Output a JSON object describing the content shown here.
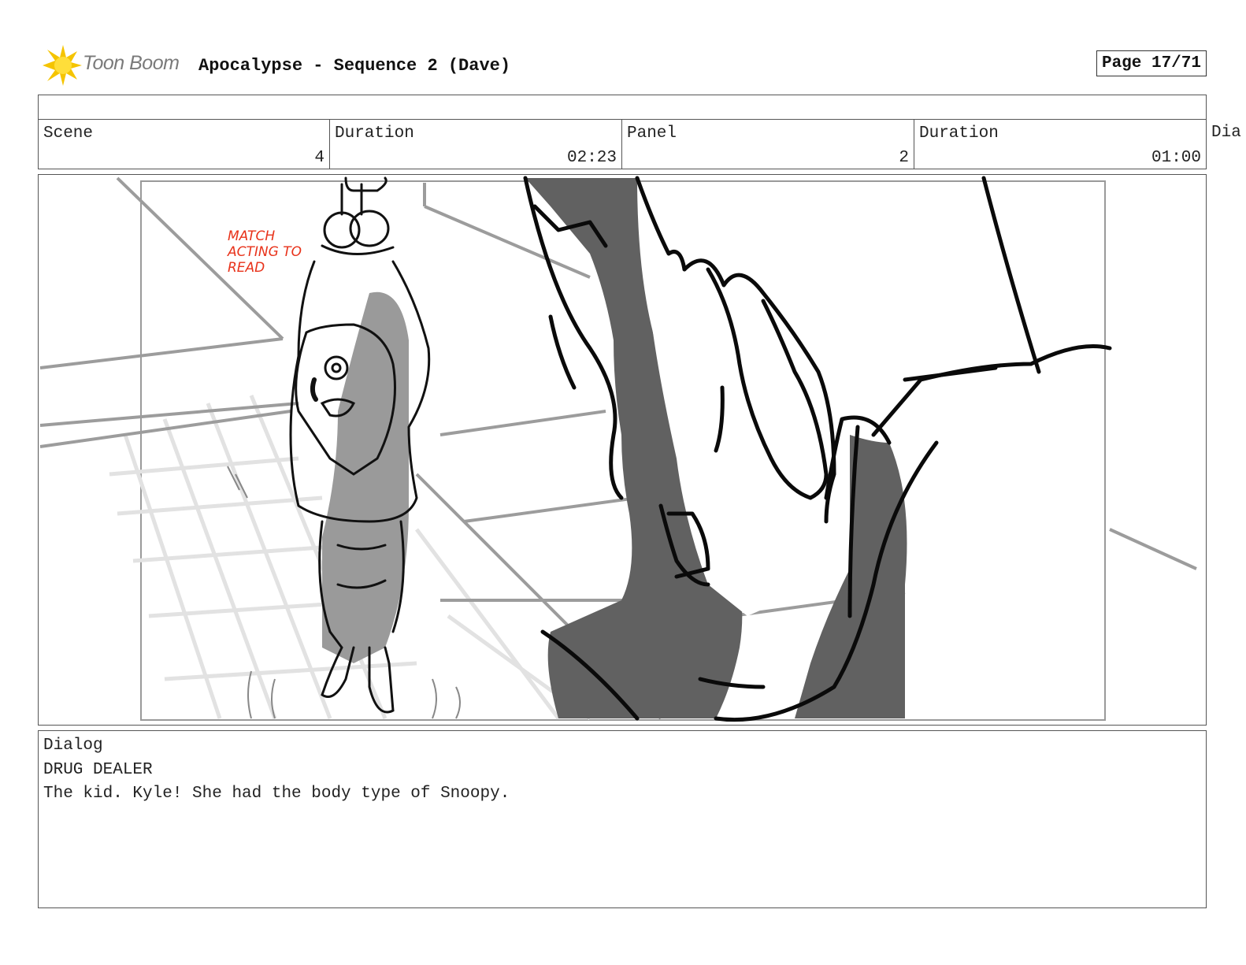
{
  "header": {
    "logo_text": "Toon Boom",
    "title": "Apocalypse - Sequence 2 (Dave)",
    "page": "Page 17/71"
  },
  "meta": {
    "scene_label": "Scene",
    "scene_value": "4",
    "scene_duration_label": "Duration",
    "scene_duration_value": "02:23",
    "panel_label": "Panel",
    "panel_value": "2",
    "panel_duration_label": "Duration",
    "panel_duration_value": "01:00",
    "overflow_label": "Dia"
  },
  "panel": {
    "note": "MATCH\nACTING TO\nREAD"
  },
  "dialog": {
    "label": "Dialog",
    "speaker": "DRUG DEALER",
    "line": "The kid. Kyle! She had the body type of Snoopy."
  },
  "colors": {
    "note_red": "#e8321a",
    "logo_yellow": "#f5c400",
    "shade_gray": "#8f8f8f",
    "dark_gray": "#616161"
  }
}
